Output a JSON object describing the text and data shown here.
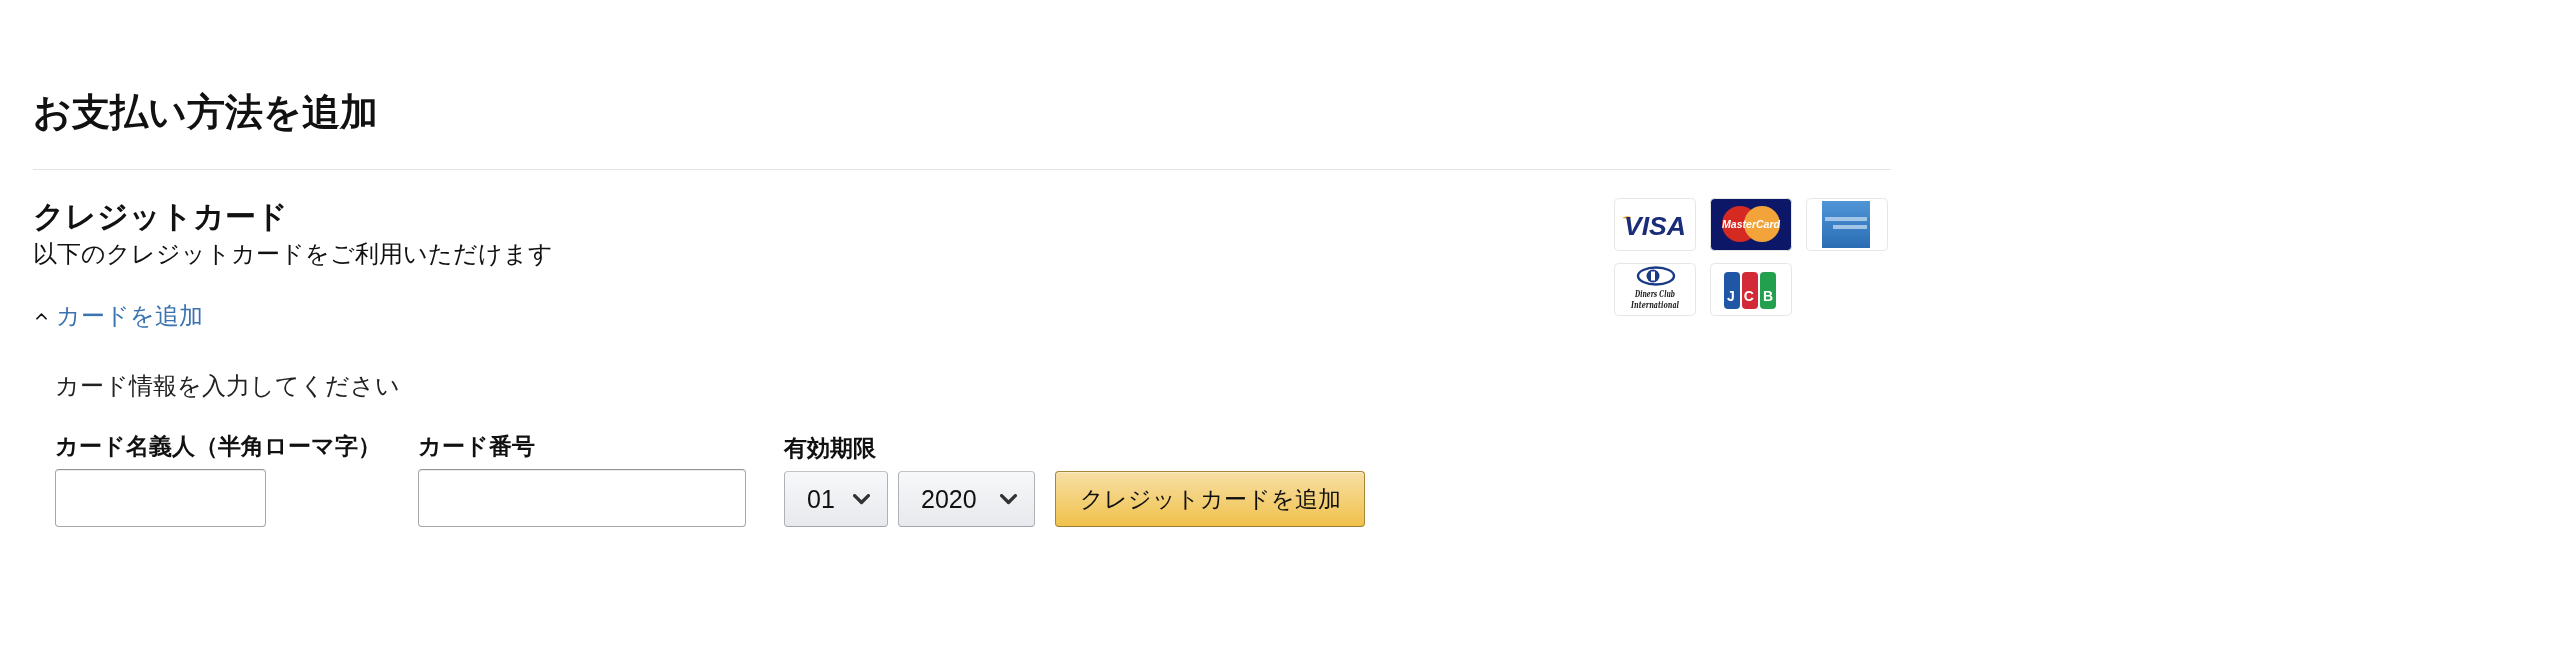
{
  "title": "お支払い方法を追加",
  "credit_card": {
    "heading": "クレジットカード",
    "description": "以下のクレジットカードをご利用いただけます",
    "accepted_cards": [
      {
        "kind": "visa",
        "lines": [
          "VISA"
        ]
      },
      {
        "kind": "mastercard",
        "lines": [
          "MasterCard"
        ]
      },
      {
        "kind": "amex"
      },
      {
        "kind": "diners",
        "lines": [
          "Diners Club",
          "International"
        ]
      },
      {
        "kind": "jcb",
        "lines": [
          "JCB"
        ]
      }
    ],
    "add_card": {
      "label": "カードを追加",
      "expanded": true
    },
    "form": {
      "instructions": "カード情報を入力してください",
      "fields": [
        {
          "kind": "text",
          "label": "カード名義人（半角ローマ字）"
        },
        {
          "kind": "text",
          "label": "カード番号"
        },
        {
          "kind": "expiry",
          "label": "有効期限",
          "month": "01",
          "year": "2020"
        }
      ],
      "submit_button": "クレジットカードを追加"
    }
  }
}
